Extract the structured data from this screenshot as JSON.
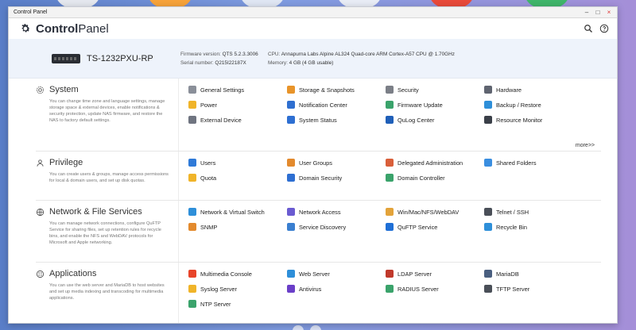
{
  "window": {
    "title": "Control Panel",
    "controls": [
      "–",
      "□",
      "×"
    ]
  },
  "header": {
    "brand_bold": "Control",
    "brand_rest": "Panel"
  },
  "device": {
    "model": "TS-1232PXU-RP",
    "fw_label": "Firmware version:",
    "fw_value": "QTS 5.2.3.3006",
    "serial_label": "Serial number:",
    "serial_value": "Q215I22187X",
    "cpu_label": "CPU:",
    "cpu_value": "Annapurna Labs Alpine AL324 Quad-core ARM Cortex-A57 CPU @ 1.70GHz",
    "mem_label": "Memory:",
    "mem_value": "4 GB (4 GB usable)"
  },
  "sections": [
    {
      "title": "System",
      "desc": "You can change time zone and language settings, manage storage space & external devices, enable notifications & security protection, update NAS firmware, and restore the NAS to factory default settings.",
      "items": [
        {
          "label": "General Settings",
          "icon": "gear-icon",
          "color": "#8a8f99"
        },
        {
          "label": "Storage & Snapshots",
          "icon": "storage-icon",
          "color": "#e8942a"
        },
        {
          "label": "Security",
          "icon": "lock-icon",
          "color": "#7b7f87"
        },
        {
          "label": "Hardware",
          "icon": "hardware-icon",
          "color": "#5f6470"
        },
        {
          "label": "Power",
          "icon": "power-icon",
          "color": "#f0b429"
        },
        {
          "label": "Notification Center",
          "icon": "notification-icon",
          "color": "#2f6fd0"
        },
        {
          "label": "Firmware Update",
          "icon": "firmware-icon",
          "color": "#3aa36b"
        },
        {
          "label": "Backup / Restore",
          "icon": "backup-icon",
          "color": "#2e8fd9"
        },
        {
          "label": "External Device",
          "icon": "external-device-icon",
          "color": "#6f7480"
        },
        {
          "label": "System Status",
          "icon": "system-status-icon",
          "color": "#2e6fd2"
        },
        {
          "label": "QuLog Center",
          "icon": "qulog-icon",
          "color": "#1f5fb8"
        },
        {
          "label": "Resource Monitor",
          "icon": "resource-monitor-icon",
          "color": "#3a3f48"
        }
      ],
      "more": "more>>"
    },
    {
      "title": "Privilege",
      "desc": "You can create users & groups, manage access permissions for local & domain users, and set up disk quotas.",
      "items": [
        {
          "label": "Users",
          "icon": "user-icon",
          "color": "#2f7ad8"
        },
        {
          "label": "User Groups",
          "icon": "user-groups-icon",
          "color": "#e38a2d"
        },
        {
          "label": "Delegated Administration",
          "icon": "delegated-admin-icon",
          "color": "#d95f3a"
        },
        {
          "label": "Shared Folders",
          "icon": "shared-folders-icon",
          "color": "#3a8ee0"
        },
        {
          "label": "Quota",
          "icon": "quota-icon",
          "color": "#f0b429"
        },
        {
          "label": "Domain Security",
          "icon": "domain-security-icon",
          "color": "#2e6fd2"
        },
        {
          "label": "Domain Controller",
          "icon": "domain-controller-icon",
          "color": "#3aa36b"
        }
      ]
    },
    {
      "title": "Network & File Services",
      "desc": "You can manage network connections, configure QuFTP Service for sharing files, set up retention rules for recycle bins, and enable the NFS and WebDAV protocols for Microsoft and Apple networking.",
      "items": [
        {
          "label": "Network & Virtual Switch",
          "icon": "network-switch-icon",
          "color": "#2e8fd9"
        },
        {
          "label": "Network Access",
          "icon": "network-access-icon",
          "color": "#6a5bd1"
        },
        {
          "label": "Win/Mac/NFS/WebDAV",
          "icon": "file-protocols-icon",
          "color": "#e3a33a"
        },
        {
          "label": "Telnet / SSH",
          "icon": "terminal-icon",
          "color": "#4a4f58"
        },
        {
          "label": "SNMP",
          "icon": "snmp-icon",
          "color": "#e38a2d"
        },
        {
          "label": "Service Discovery",
          "icon": "service-discovery-icon",
          "color": "#3a7fd0"
        },
        {
          "label": "QuFTP Service",
          "icon": "quftp-icon",
          "color": "#1f6fd6"
        },
        {
          "label": "Recycle Bin",
          "icon": "recycle-bin-icon",
          "color": "#2e8fd9"
        }
      ]
    },
    {
      "title": "Applications",
      "desc": "You can use the web server and MariaDB to host websites and set up media indexing and transcoding for multimedia applications.",
      "items": [
        {
          "label": "Multimedia Console",
          "icon": "multimedia-icon",
          "color": "#e8442a"
        },
        {
          "label": "Web Server",
          "icon": "web-server-icon",
          "color": "#2e8fd9"
        },
        {
          "label": "LDAP Server",
          "icon": "ldap-icon",
          "color": "#c0392b"
        },
        {
          "label": "MariaDB",
          "icon": "mariadb-icon",
          "color": "#4a5f80"
        },
        {
          "label": "Syslog Server",
          "icon": "syslog-icon",
          "color": "#f0b429"
        },
        {
          "label": "Antivirus",
          "icon": "antivirus-icon",
          "color": "#6a3fc8"
        },
        {
          "label": "RADIUS Server",
          "icon": "radius-icon",
          "color": "#3aa36b"
        },
        {
          "label": "TFTP Server",
          "icon": "tftp-icon",
          "color": "#4a4f58"
        },
        {
          "label": "NTP Server",
          "icon": "ntp-icon",
          "color": "#3aa36b"
        }
      ]
    }
  ]
}
